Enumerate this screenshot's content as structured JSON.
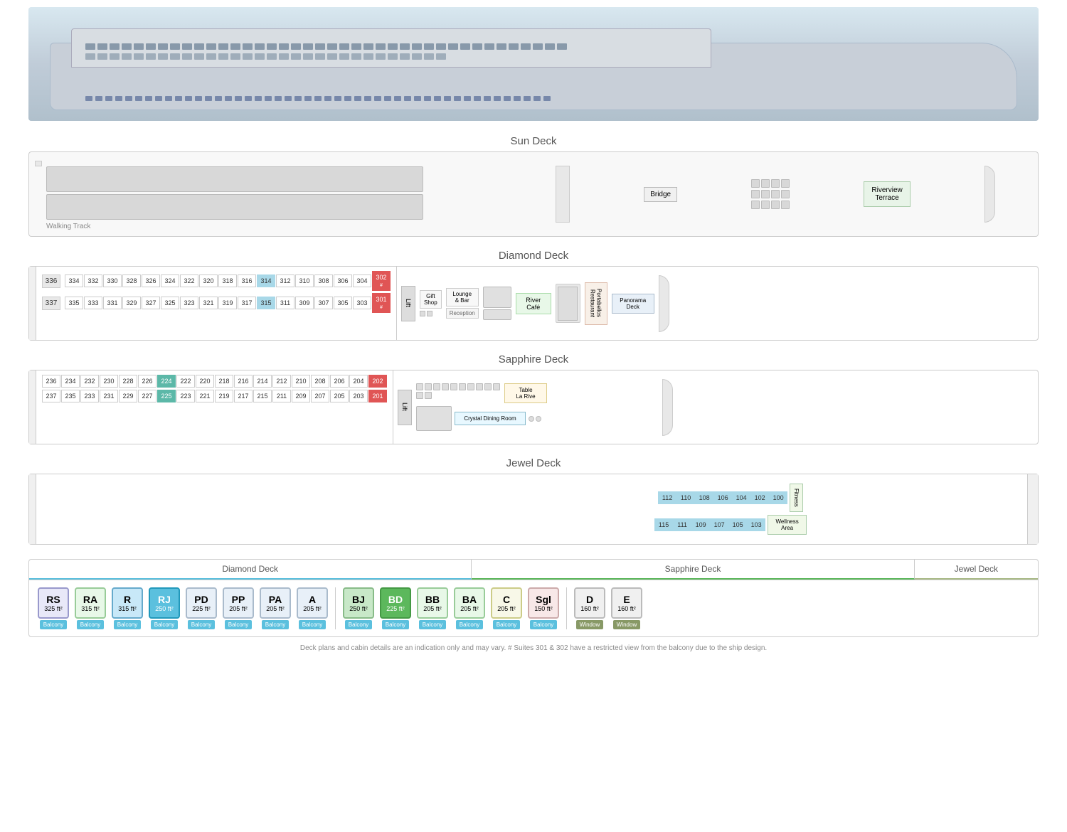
{
  "ship": {
    "image_alt": "River Cruise Ship"
  },
  "decks": {
    "sun": {
      "title": "Sun Deck",
      "walking_track": "Walking Track",
      "bridge": "Bridge",
      "riverview_terrace": "Riverview\nTerrace"
    },
    "diamond": {
      "title": "Diamond Deck",
      "even_row": [
        "336",
        "334",
        "332",
        "330",
        "328",
        "326",
        "324",
        "322",
        "320",
        "318",
        "316",
        "314",
        "312",
        "310",
        "308",
        "306",
        "304",
        "302"
      ],
      "odd_row": [
        "337",
        "335",
        "333",
        "331",
        "329",
        "327",
        "325",
        "323",
        "321",
        "319",
        "317",
        "315",
        "311",
        "309",
        "307",
        "305",
        "303",
        "301"
      ],
      "lift": "Lift",
      "gift_shop": "Gift\nShop",
      "lounge": "Lounge\n& Bar",
      "reception": "Reception",
      "river_cafe": "River\nCafé",
      "portabellos": "Portabellos\nRestaurant",
      "panorama": "Panorama\nDeck"
    },
    "sapphire": {
      "title": "Sapphire Deck",
      "even_row": [
        "236",
        "234",
        "232",
        "230",
        "228",
        "226",
        "224",
        "222",
        "220",
        "218",
        "216",
        "214",
        "212",
        "210",
        "208",
        "206",
        "204",
        "202"
      ],
      "odd_row": [
        "237",
        "235",
        "233",
        "231",
        "229",
        "227",
        "225",
        "223",
        "221",
        "219",
        "217",
        "215",
        "211",
        "209",
        "207",
        "205",
        "203",
        "201"
      ],
      "lift": "Lift",
      "table_la_rive": "Table\nLa Rive",
      "crystal_dining": "Crystal Dining Room"
    },
    "jewel": {
      "title": "Jewel Deck",
      "top_row": [
        "112",
        "110",
        "108",
        "106",
        "104",
        "102",
        "100"
      ],
      "bottom_row": [
        "115",
        "111",
        "109",
        "107",
        "105",
        "103"
      ],
      "fitness": "Fitness",
      "wellness": "Wellness\nArea"
    }
  },
  "legend": {
    "diamond_deck_label": "Diamond Deck",
    "sapphire_deck_label": "Sapphire Deck",
    "jewel_deck_label": "Jewel Deck",
    "items": [
      {
        "code": "RS",
        "size": "325 ft²",
        "type": "Balcony",
        "style": "badge-rs"
      },
      {
        "code": "RA",
        "size": "315 ft²",
        "type": "Balcony",
        "style": "badge-ra"
      },
      {
        "code": "R",
        "size": "315 ft²",
        "type": "Balcony",
        "style": "badge-r"
      },
      {
        "code": "RJ",
        "size": "250 ft²",
        "type": "Balcony",
        "style": "badge-rj"
      },
      {
        "code": "PD",
        "size": "225 ft²",
        "type": "Balcony",
        "style": "badge-pd"
      },
      {
        "code": "PP",
        "size": "205 ft²",
        "type": "Balcony",
        "style": "badge-pp"
      },
      {
        "code": "PA",
        "size": "205 ft²",
        "type": "Balcony",
        "style": "badge-pa"
      },
      {
        "code": "A",
        "size": "205 ft²",
        "type": "Balcony",
        "style": "badge-a"
      },
      {
        "code": "BJ",
        "size": "250 ft²",
        "type": "Balcony",
        "style": "badge-bj"
      },
      {
        "code": "BD",
        "size": "225 ft²",
        "type": "Balcony",
        "style": "badge-bd"
      },
      {
        "code": "BB",
        "size": "205 ft²",
        "type": "Balcony",
        "style": "badge-bb"
      },
      {
        "code": "BA",
        "size": "205 ft²",
        "type": "Balcony",
        "style": "badge-ba"
      },
      {
        "code": "C",
        "size": "205 ft²",
        "type": "Balcony",
        "style": "badge-c"
      },
      {
        "code": "Sgl",
        "size": "150 ft²",
        "type": "Balcony",
        "style": "badge-sgl"
      },
      {
        "code": "D",
        "size": "160 ft²",
        "type": "Window",
        "style": "badge-d"
      },
      {
        "code": "E",
        "size": "160 ft²",
        "type": "Window",
        "style": "badge-e"
      }
    ]
  },
  "footnote": "Deck plans and cabin details are an indication only and may vary.  # Suites 301 & 302 have a restricted view from the balcony due to the ship design."
}
